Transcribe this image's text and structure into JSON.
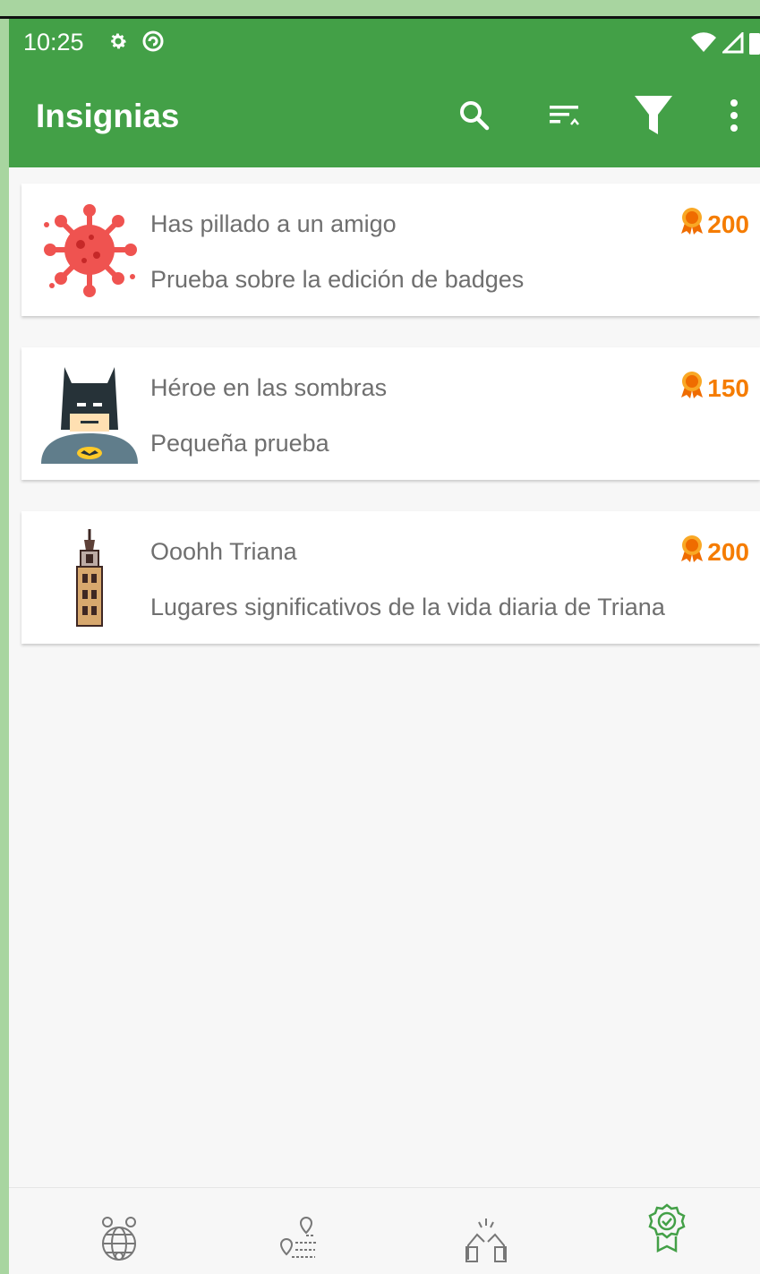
{
  "status_bar": {
    "time": "10:25",
    "left_icons": [
      "settings-icon",
      "sync-icon"
    ],
    "right_icons": [
      "wifi-icon",
      "signal-icon",
      "battery-icon"
    ]
  },
  "app_bar": {
    "title": "Insignias",
    "actions": [
      "search-icon",
      "sort-icon",
      "filter-icon",
      "more-vert-icon"
    ],
    "color": "#43a047"
  },
  "badges": [
    {
      "title": "Has pillado a un amigo",
      "description": "Prueba sobre la edición de badges",
      "points": "200",
      "icon": "virus-icon"
    },
    {
      "title": "Héroe en las sombras",
      "description": "Pequeña prueba",
      "points": "150",
      "icon": "batman-icon"
    },
    {
      "title": "Ooohh Triana",
      "description": "Lugares significativos de la vida diaria de Triana",
      "points": "200",
      "icon": "tower-icon"
    }
  ],
  "points_color": "#f57c00",
  "bottom_nav": {
    "items": [
      "world-map-icon",
      "route-icon",
      "community-icon",
      "badge-icon"
    ],
    "selected_index": 3,
    "selected_color": "#43a047"
  }
}
